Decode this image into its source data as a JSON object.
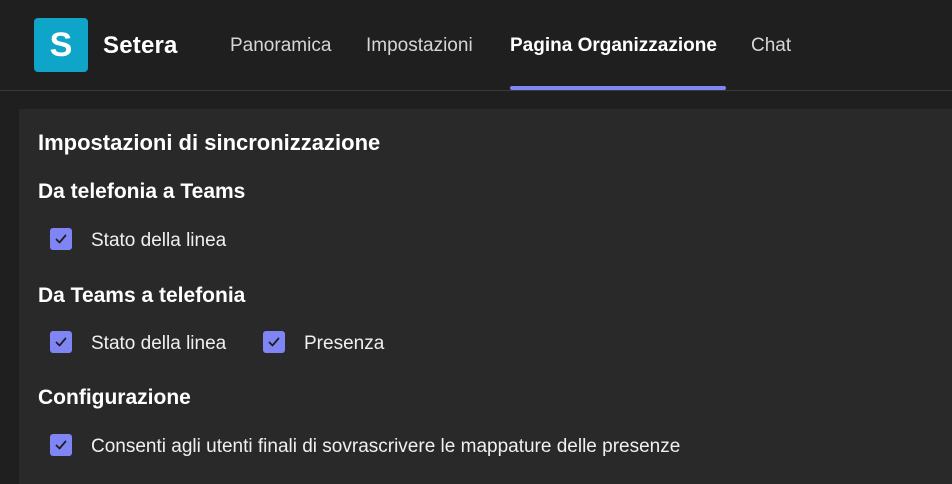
{
  "app": {
    "logo_letter": "S",
    "name": "Setera"
  },
  "tabs": [
    {
      "label": "Panoramica",
      "active": false
    },
    {
      "label": "Impostazioni",
      "active": false
    },
    {
      "label": "Pagina Organizzazione",
      "active": true
    },
    {
      "label": "Chat",
      "active": false
    }
  ],
  "settings": {
    "title": "Impostazioni di sincronizzazione",
    "sections": [
      {
        "heading": "Da telefonia a Teams",
        "options": [
          {
            "label": "Stato della linea",
            "checked": true
          }
        ]
      },
      {
        "heading": "Da Teams a telefonia",
        "options": [
          {
            "label": "Stato della linea",
            "checked": true
          },
          {
            "label": "Presenza",
            "checked": true
          }
        ]
      },
      {
        "heading": "Configurazione",
        "options": [
          {
            "label": "Consenti agli utenti finali di sovrascrivere le mappature delle presenze",
            "checked": true
          }
        ]
      }
    ]
  },
  "colors": {
    "accent": "#7f85f5",
    "logo": "#0ea5c9",
    "background": "#1f1f1f",
    "panel": "#292929"
  }
}
